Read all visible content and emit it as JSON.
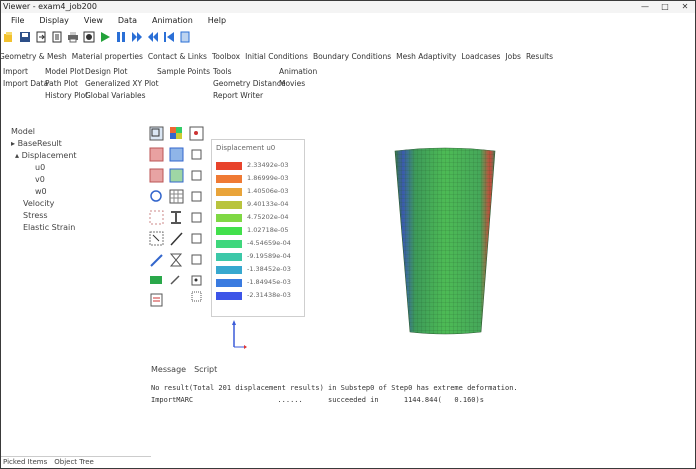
{
  "window": {
    "title": "Viewer - exam4_job200",
    "min_label": "—",
    "max_label": "□",
    "close_label": "✕"
  },
  "menu": [
    "File",
    "Display",
    "View",
    "Data",
    "Animation",
    "Help"
  ],
  "tabs": [
    "Geometry & Mesh",
    "Material properties",
    "Contact & Links",
    "Toolbox",
    "Initial Conditions",
    "Boundary Conditions",
    "Mesh Adaptivity",
    "Loadcases",
    "Jobs",
    "Results"
  ],
  "results_menu": {
    "col1": [
      "Import",
      "Import Data",
      ""
    ],
    "col2": [
      "Model Plot",
      "Path Plot",
      "History Plot"
    ],
    "col3": [
      "Design Plot",
      "Generalized XY Plot",
      "Global Variables"
    ],
    "col4": [
      "Sample Points",
      "",
      ""
    ],
    "col5": [
      "Tools",
      "Geometry Distance",
      "Report Writer"
    ],
    "col6": [
      "Animation",
      "Movies",
      ""
    ]
  },
  "tree": {
    "model": "Model",
    "base_result": "BaseResult",
    "displacement": "Displacement",
    "u0": "u0",
    "v0": "v0",
    "w0": "w0",
    "velocity": "Velocity",
    "stress": "Stress",
    "elastic_strain": "Elastic Strain"
  },
  "legend": {
    "title": "Displacement u0",
    "values": [
      "2.33492e-03",
      "1.86999e-03",
      "1.40506e-03",
      "9.40133e-04",
      "4.75202e-04",
      "1.02718e-05",
      "-4.54659e-04",
      "-9.19589e-04",
      "-1.38452e-03",
      "-1.84945e-03",
      "-2.31438e-03"
    ],
    "colors": [
      "#e8432b",
      "#ef7a34",
      "#e9a43a",
      "#b9c43e",
      "#7fd844",
      "#42e04c",
      "#3fd77c",
      "#3cc8a8",
      "#37a8cf",
      "#3a7be0",
      "#3d55e8"
    ]
  },
  "messages": {
    "tabs": [
      "Message",
      "Script"
    ],
    "line1": "No result(Total 201 displacement results) in Substep0 of Step0 has extreme deformation.",
    "line2": "ImportMARC                    ......      succeeded in      1144.844(   0.160)s"
  },
  "bottom_tabs": [
    "Picked Items",
    "Object Tree"
  ]
}
